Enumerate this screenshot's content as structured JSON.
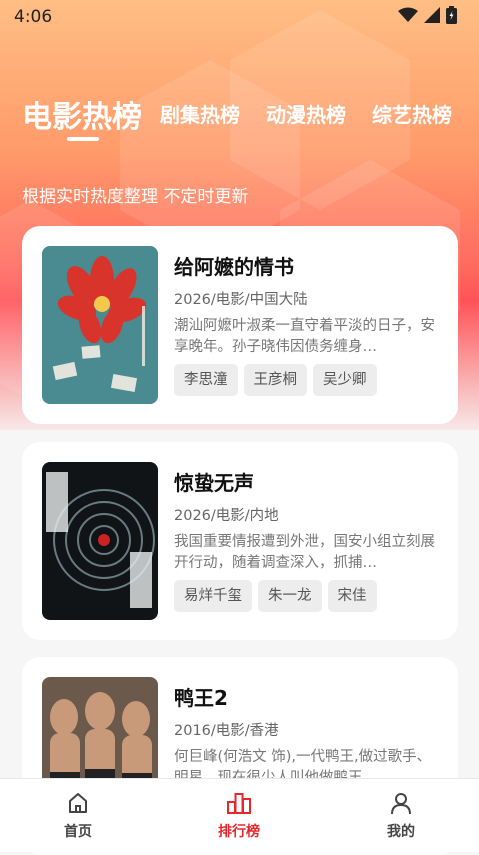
{
  "status_bar": {
    "time": "4:06",
    "icons": [
      "wifi-icon",
      "signal-icon",
      "battery-icon"
    ]
  },
  "tabs": [
    {
      "label": "电影热榜",
      "active": true
    },
    {
      "label": "剧集热榜",
      "active": false
    },
    {
      "label": "动漫热榜",
      "active": false
    },
    {
      "label": "综艺热榜",
      "active": false
    }
  ],
  "subtitle": "根据实时热度整理 不定时更新",
  "movies": [
    {
      "title": "给阿嬷的情书",
      "meta": "2026/电影/中国大陆",
      "desc": "潮汕阿嬷叶淑柔一直守着平淡的日子，安享晚年。孙子晓伟因债务缠身…",
      "tags": [
        "李思潼",
        "王彦桐",
        "吴少卿"
      ]
    },
    {
      "title": "惊蛰无声",
      "meta": "2026/电影/内地",
      "desc": "我国重要情报遭到外泄，国安小组立刻展开行动，随着调查深入，抓捕…",
      "tags": [
        "易烊千玺",
        "朱一龙",
        "宋佳"
      ]
    },
    {
      "title": "鸭王2",
      "meta": "2016/电影/香港",
      "desc": "何巨峰(何浩文 饰),一代鸭王,做过歌手、明星，现在很少人叫他做鸭王…",
      "tags": []
    }
  ],
  "bottom_nav": [
    {
      "label": "首页",
      "icon": "home-icon",
      "active": false
    },
    {
      "label": "排行榜",
      "icon": "ranking-icon",
      "active": true
    },
    {
      "label": "我的",
      "icon": "profile-icon",
      "active": false
    }
  ],
  "colors": {
    "accent": "#e8262b",
    "hero_top": "#ffbe84",
    "hero_bottom": "#ff5357"
  }
}
